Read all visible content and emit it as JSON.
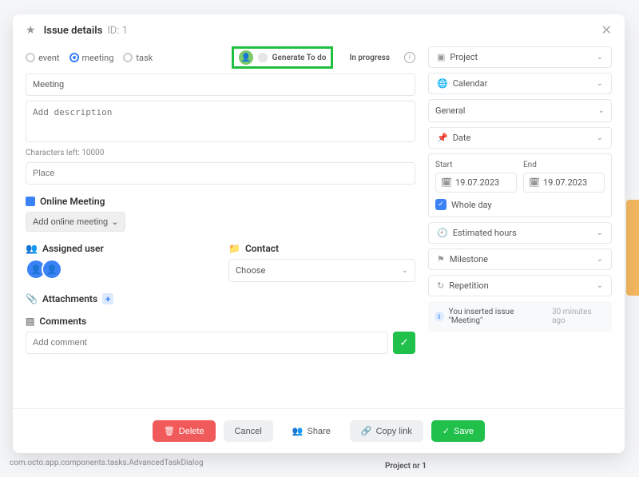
{
  "header": {
    "title": "Issue details",
    "id_label": "ID: 1"
  },
  "types": {
    "event": "event",
    "meeting": "meeting",
    "task": "task"
  },
  "generate": {
    "label": "Generate To do",
    "status": "In progress"
  },
  "main": {
    "title_value": "Meeting",
    "desc_placeholder": "Add description",
    "chars_left": "Characters left: 10000",
    "place_placeholder": "Place"
  },
  "online": {
    "title": "Online Meeting",
    "button": "Add online meeting"
  },
  "assigned": {
    "title": "Assigned user"
  },
  "contact": {
    "title": "Contact",
    "placeholder": "Choose"
  },
  "attachments": {
    "title": "Attachments"
  },
  "comments": {
    "title": "Comments",
    "placeholder": "Add comment"
  },
  "right": {
    "project": "Project",
    "calendar": "Calendar",
    "calendar_value": "General",
    "date": "Date",
    "start": "Start",
    "end": "End",
    "start_value": "19.07.2023",
    "end_value": "19.07.2023",
    "whole_day": "Whole day",
    "estimated": "Estimated hours",
    "milestone": "Milestone",
    "repetition": "Repetition",
    "activity_text": "You inserted issue \"Meeting\"",
    "activity_time": "30 minutes ago"
  },
  "footer": {
    "delete": "Delete",
    "cancel": "Cancel",
    "share": "Share",
    "copy": "Copy link",
    "save": "Save"
  },
  "debug": "com.octo.app.components.tasks.AdvancedTaskDialog",
  "bg_project": "Project nr 1"
}
